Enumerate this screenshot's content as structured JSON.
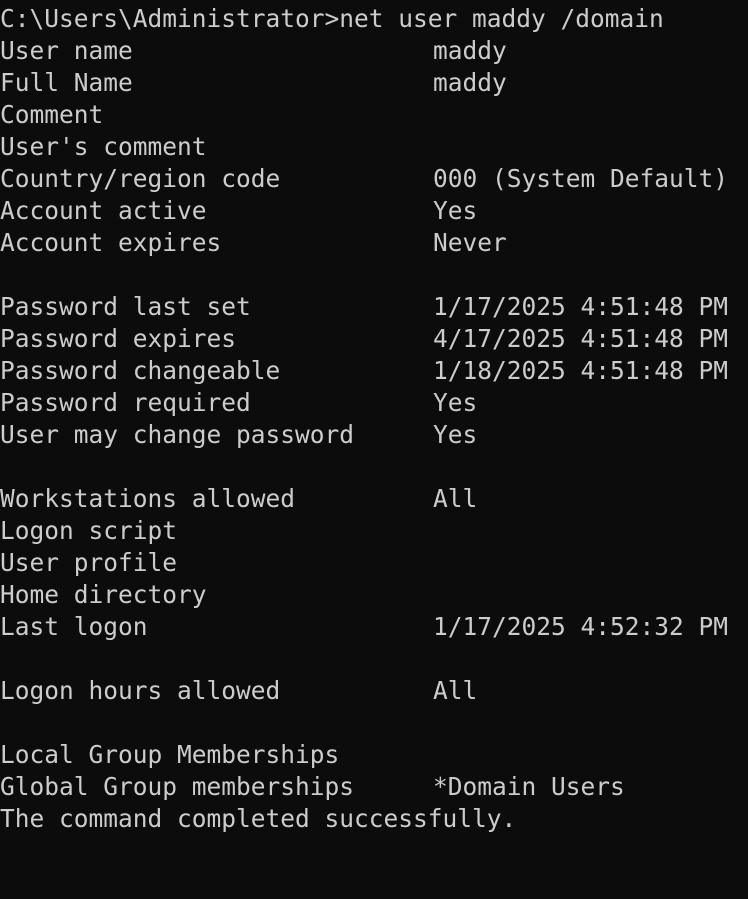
{
  "terminal": {
    "prompt": "C:\\Users\\Administrator>",
    "command": "net user maddy /domain",
    "rows": [
      {
        "key": "User name",
        "value": "maddy"
      },
      {
        "key": "Full Name",
        "value": "maddy"
      },
      {
        "key": "Comment",
        "value": ""
      },
      {
        "key": "User's comment",
        "value": ""
      },
      {
        "key": "Country/region code",
        "value": "000 (System Default)"
      },
      {
        "key": "Account active",
        "value": "Yes"
      },
      {
        "key": "Account expires",
        "value": "Never"
      },
      {
        "key": "",
        "value": ""
      },
      {
        "key": "Password last set",
        "value": "1/17/2025 4:51:48 PM"
      },
      {
        "key": "Password expires",
        "value": "4/17/2025 4:51:48 PM"
      },
      {
        "key": "Password changeable",
        "value": "1/18/2025 4:51:48 PM"
      },
      {
        "key": "Password required",
        "value": "Yes"
      },
      {
        "key": "User may change password",
        "value": "Yes"
      },
      {
        "key": "",
        "value": ""
      },
      {
        "key": "Workstations allowed",
        "value": "All"
      },
      {
        "key": "Logon script",
        "value": ""
      },
      {
        "key": "User profile",
        "value": ""
      },
      {
        "key": "Home directory",
        "value": ""
      },
      {
        "key": "Last logon",
        "value": "1/17/2025 4:52:32 PM"
      },
      {
        "key": "",
        "value": ""
      },
      {
        "key": "Logon hours allowed",
        "value": "All"
      },
      {
        "key": "",
        "value": ""
      },
      {
        "key": "Local Group Memberships",
        "value": ""
      },
      {
        "key": "Global Group memberships",
        "value": "*Domain Users"
      }
    ],
    "completion_message": "The command completed successfully."
  },
  "colors": {
    "background": "#0c0c0c",
    "foreground": "#cccccc"
  }
}
